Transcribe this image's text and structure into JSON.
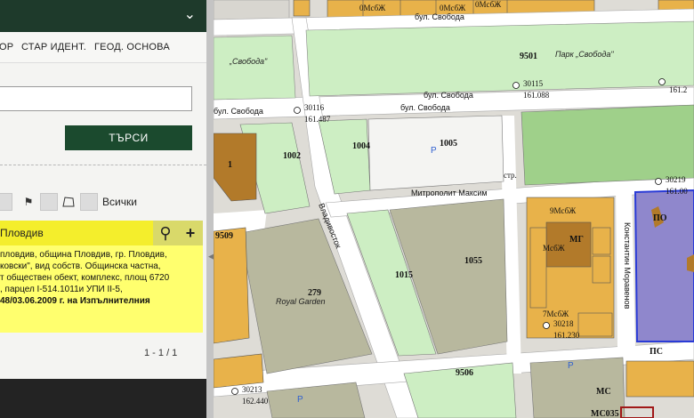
{
  "panel": {
    "tabs": [
      "ОР",
      "СТАР ИДЕНТ.",
      "ГЕОД. ОСНОВА"
    ],
    "search_button": "ТЪРСИ",
    "tools_all_label": "Всички",
    "result_header": "Пловдив",
    "result_lines": [
      "пловдив, община Пловдив, гр. Пловдив,",
      "ковски\", вид собств. Общинска частна,",
      "т обществен обект, комплекс, площ 6720",
      ", парцел I-514.1011и УПИ II-5,",
      "48/03.06.2009 г. на Изпълнителния"
    ],
    "result_line_last_bold": "48/03.06.2009 г.",
    "pager": "1 - 1 / 1"
  },
  "map": {
    "streets": {
      "s1": "бул. Свобода",
      "s2": "бул. Свобода",
      "s3": "бул. Свобода",
      "s4": "бул. Свобода",
      "s5": "Митрополит Максим",
      "s6": "Владивосток",
      "s7": "Константин Моравенов"
    },
    "park_labels": {
      "p1": "Парк „Свобода\"",
      "p2": "„Свобода\"",
      "p3": "Royal Garden"
    },
    "parcels": [
      "9501",
      "1004",
      "1005",
      "1002",
      "1",
      "1015",
      "1055",
      "279",
      "9509",
      "9506",
      "МС",
      "МС035",
      "МГ",
      "ПС",
      "ПО",
      "0МсбЖ",
      "0МсбЖ",
      "0МсбЖ",
      "9МсбЖ",
      "МсбЖ",
      "7МсбЖ",
      "стр."
    ],
    "points": [
      {
        "id": "30115",
        "elev": "161.088"
      },
      {
        "id": "30116",
        "elev": "161.487"
      },
      {
        "id": "30219",
        "elev": "161.00"
      },
      {
        "id": "30218",
        "elev": "161.230"
      },
      {
        "id": "30213",
        "elev": "162.440"
      },
      {
        "id": "",
        "elev": "161.2"
      }
    ],
    "colors": {
      "building": "#e8b24a",
      "park": "#cdeec3",
      "green": "#9fd08a",
      "road": "#ffffff",
      "olive": "#b8b89e",
      "purple": "#8f87cc",
      "blue_outline": "#2a3bd6"
    }
  }
}
